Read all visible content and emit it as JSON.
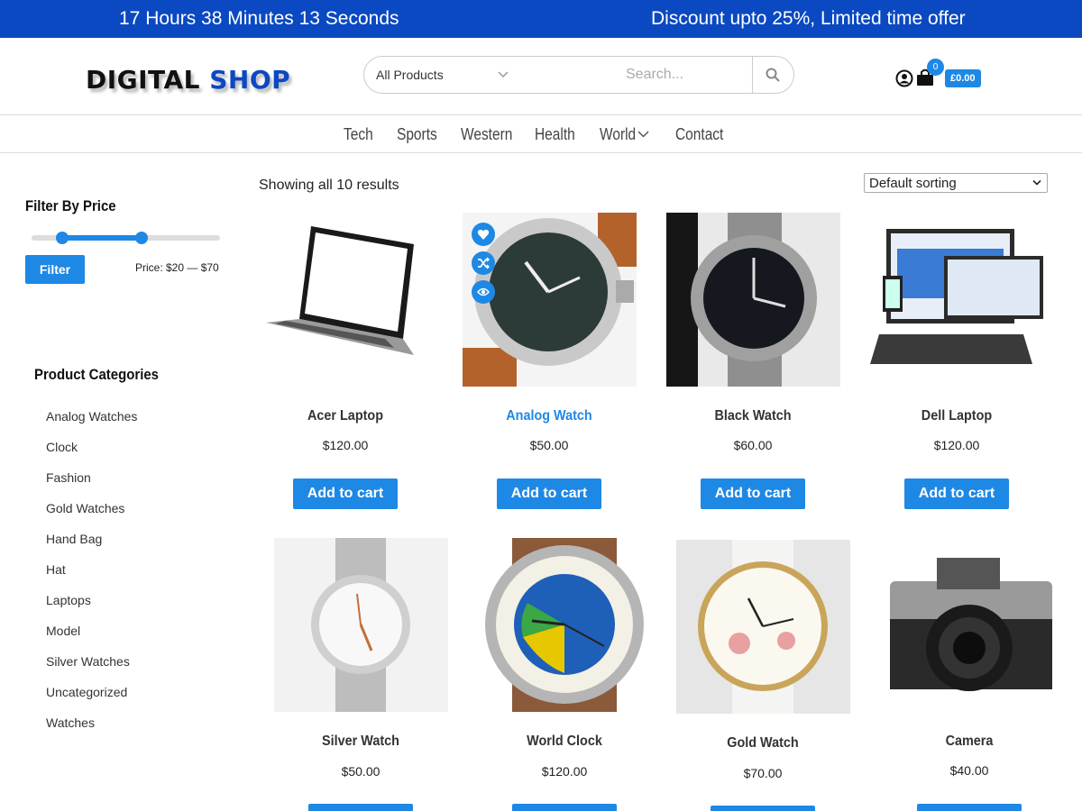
{
  "topbar": {
    "countdown": "17 Hours 38 Minutes 13 Seconds",
    "offer": "Discount upto 25%, Limited time offer"
  },
  "header": {
    "logo_part1": "DIGITAL",
    "logo_part2": "SHOP",
    "category_select": "All Products",
    "search_placeholder": "Search...",
    "cart_count": "0",
    "cart_total": "£0.00"
  },
  "nav": {
    "items": [
      "Tech",
      "Sports",
      "Western",
      "Health",
      "World",
      "Contact"
    ]
  },
  "sidebar": {
    "filter_title": "Filter By Price",
    "filter_button": "Filter",
    "price_range": "Price: $20 — $70",
    "categories_title": "Product Categories",
    "categories": [
      "Analog Watches",
      "Clock",
      "Fashion",
      "Gold Watches",
      "Hand Bag",
      "Hat",
      "Laptops",
      "Model",
      "Silver Watches",
      "Uncategorized",
      "Watches"
    ]
  },
  "shop": {
    "result_count": "Showing all 10 results",
    "sorting": "Default sorting",
    "add_to_cart": "Add to cart"
  },
  "products": [
    {
      "name": "Acer Laptop",
      "price": "$120.00"
    },
    {
      "name": "Analog Watch",
      "price": "$50.00"
    },
    {
      "name": "Black Watch",
      "price": "$60.00"
    },
    {
      "name": "Dell Laptop",
      "price": "$120.00"
    },
    {
      "name": "Silver Watch",
      "price": "$50.00"
    },
    {
      "name": "World Clock",
      "price": "$120.00"
    },
    {
      "name": "Gold Watch",
      "price": "$70.00"
    },
    {
      "name": "Camera",
      "price": "$40.00"
    }
  ],
  "colors": {
    "brand": "#0a49c2",
    "accent": "#1e88e5"
  }
}
